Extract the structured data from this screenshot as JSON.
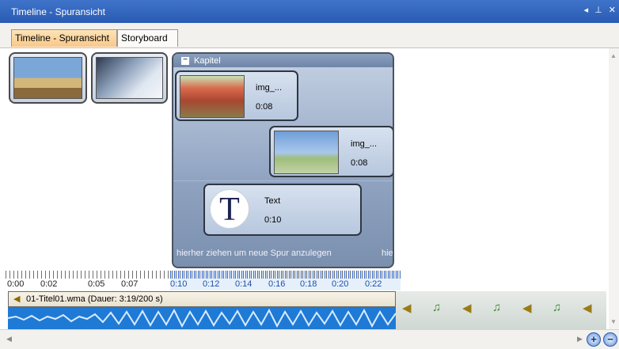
{
  "window": {
    "title": "Timeline - Spuransicht"
  },
  "tabs": [
    {
      "label": "Timeline - Spuransicht",
      "active": true
    },
    {
      "label": "Storyboard",
      "active": false
    }
  ],
  "chapter": {
    "label": "Kapitel"
  },
  "clips": [
    {
      "name": "img_...",
      "duration": "0:08"
    },
    {
      "name": "img_...",
      "duration": "0:08"
    },
    {
      "name": "Text",
      "duration": "0:10"
    }
  ],
  "dropzone": {
    "text": "hierher ziehen um neue Spur anzulegen",
    "text_overflow": "hie"
  },
  "ruler": {
    "labels": [
      "0:00",
      "0:02",
      "0:05",
      "0:07",
      "0:10",
      "0:12",
      "0:14",
      "0:16",
      "0:18",
      "0:20",
      "0:22"
    ]
  },
  "audio": {
    "label": "01-Titel01.wma (Dauer: 3:19/200 s)"
  },
  "icons": {
    "text_clip_letter": "T"
  },
  "colors": {
    "titlebar": "#2a5bb4",
    "active_tab": "#f9c88a",
    "waveform": "#1f7ad6",
    "timeline_selection": "#e6f0fb"
  }
}
